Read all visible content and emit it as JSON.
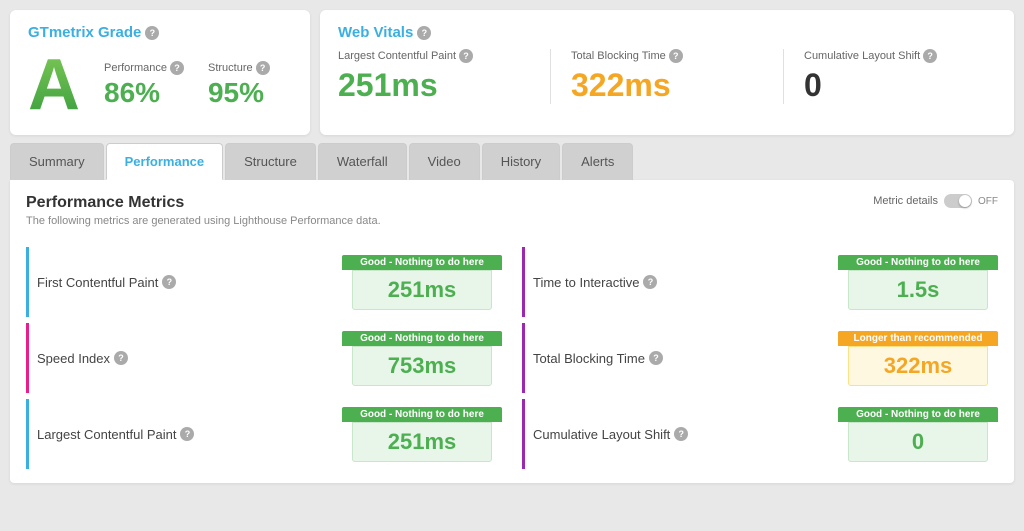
{
  "header": {
    "gtmetrix_label": "GTmetrix Grade",
    "web_vitals_label": "Web Vitals"
  },
  "grade": {
    "letter": "A",
    "performance_label": "Performance",
    "performance_value": "86%",
    "structure_label": "Structure",
    "structure_value": "95%"
  },
  "web_vitals": {
    "lcp_label": "Largest Contentful Paint",
    "lcp_value": "251ms",
    "tbt_label": "Total Blocking Time",
    "tbt_value": "322ms",
    "cls_label": "Cumulative Layout Shift",
    "cls_value": "0"
  },
  "tabs": [
    {
      "label": "Summary",
      "active": false
    },
    {
      "label": "Performance",
      "active": true
    },
    {
      "label": "Structure",
      "active": false
    },
    {
      "label": "Waterfall",
      "active": false
    },
    {
      "label": "Video",
      "active": false
    },
    {
      "label": "History",
      "active": false
    },
    {
      "label": "Alerts",
      "active": false
    }
  ],
  "performance": {
    "title": "Performance Metrics",
    "subtitle": "The following metrics are generated using Lighthouse Performance data.",
    "metric_details_label": "Metric details",
    "toggle_label": "OFF",
    "metrics": [
      {
        "id": "fcp",
        "label": "First Contentful Paint",
        "status": "Good - Nothing to do here",
        "status_type": "good",
        "value": "251ms",
        "value_type": "green",
        "border": "blue"
      },
      {
        "id": "tti",
        "label": "Time to Interactive",
        "status": "Good - Nothing to do here",
        "status_type": "good",
        "value": "1.5s",
        "value_type": "green",
        "border": "purple"
      },
      {
        "id": "si",
        "label": "Speed Index",
        "status": "Good - Nothing to do here",
        "status_type": "good",
        "value": "753ms",
        "value_type": "green",
        "border": "pink"
      },
      {
        "id": "tbt",
        "label": "Total Blocking Time",
        "status": "Longer than recommended",
        "status_type": "warn",
        "value": "322ms",
        "value_type": "orange",
        "border": "purple"
      },
      {
        "id": "lcp",
        "label": "Largest Contentful Paint",
        "status": "Good - Nothing to do here",
        "status_type": "good",
        "value": "251ms",
        "value_type": "green",
        "border": "blue"
      },
      {
        "id": "cls",
        "label": "Cumulative Layout Shift",
        "status": "Good - Nothing to do here",
        "status_type": "good",
        "value": "0",
        "value_type": "green",
        "border": "purple"
      }
    ]
  }
}
